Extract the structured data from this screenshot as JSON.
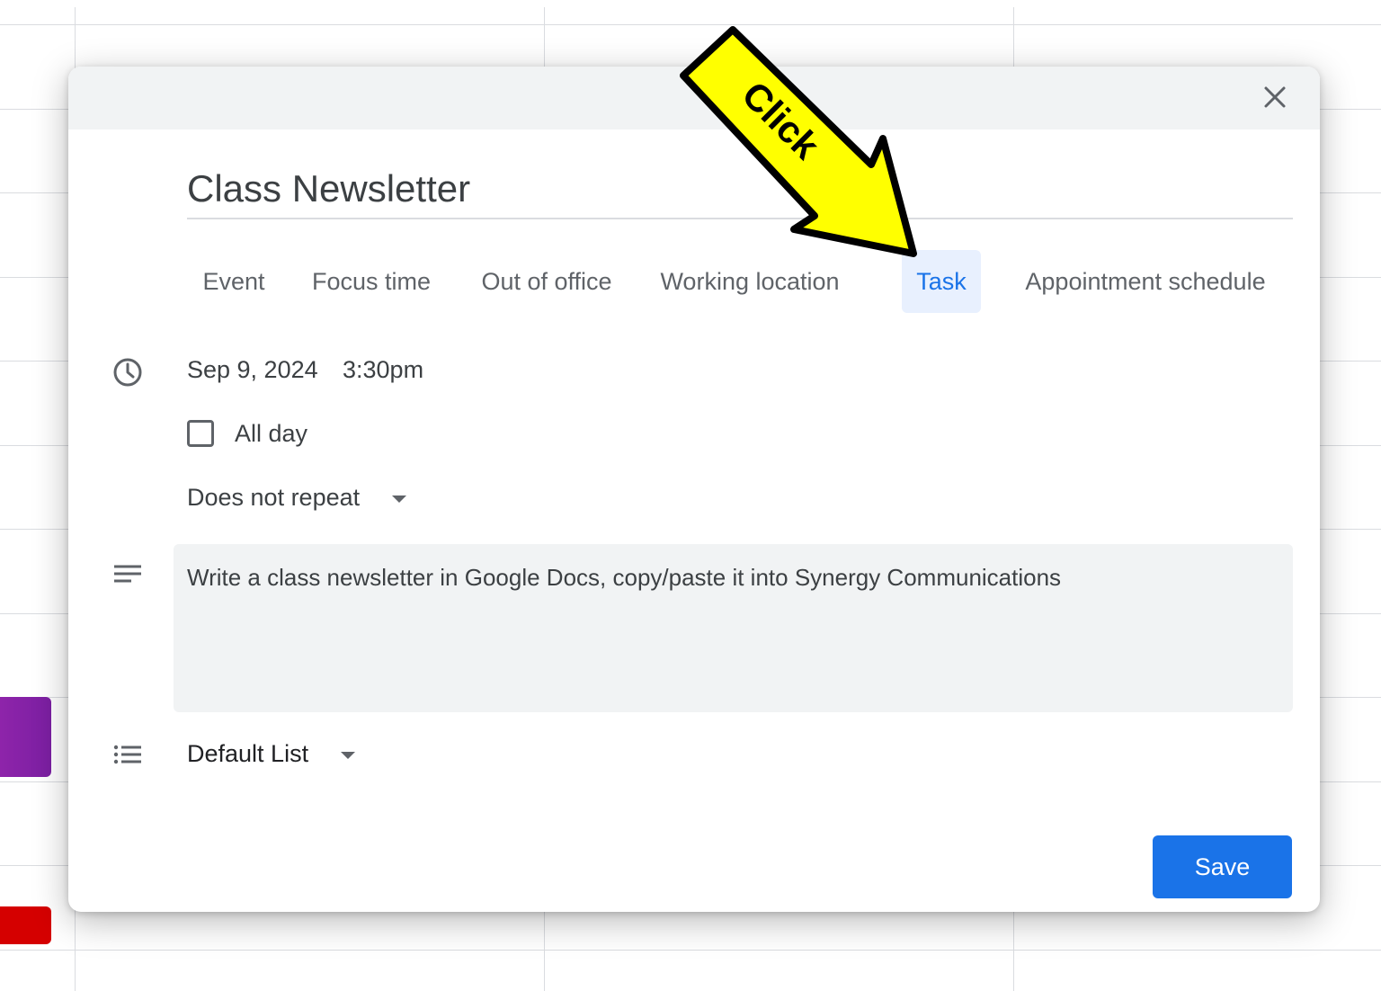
{
  "dialog": {
    "title": "Class Newsletter",
    "tabs": [
      {
        "label": "Event",
        "active": false
      },
      {
        "label": "Focus time",
        "active": false
      },
      {
        "label": "Out of office",
        "active": false
      },
      {
        "label": "Working location",
        "active": false
      },
      {
        "label": "Task",
        "active": true
      },
      {
        "label": "Appointment schedule",
        "active": false
      }
    ],
    "date": "Sep 9, 2024",
    "time": "3:30pm",
    "all_day_label": "All day",
    "all_day_checked": false,
    "repeat": "Does not repeat",
    "description": "Write a class newsletter in Google Docs, copy/paste it into Synergy Communications",
    "list": "Default List",
    "save_label": "Save"
  },
  "annotation": {
    "label": "Click",
    "color": "#ffff00"
  },
  "colors": {
    "accent": "#1a73e8",
    "active_tab_bg": "#e8f0fe",
    "header_bg": "#f1f3f4",
    "event_purple": "#8e24aa",
    "event_red": "#d50000"
  },
  "icons": [
    "close-icon",
    "clock-icon",
    "description-icon",
    "task-list-icon",
    "dropdown-arrow-icon"
  ]
}
